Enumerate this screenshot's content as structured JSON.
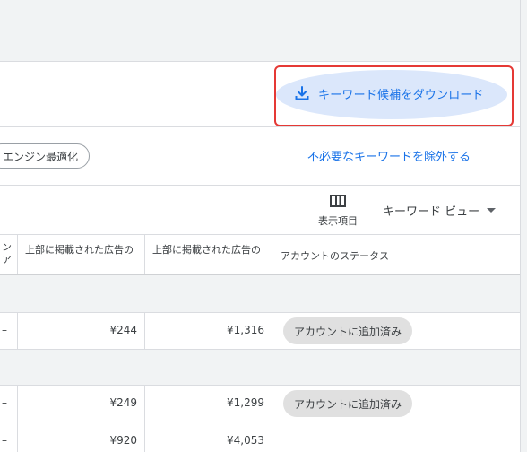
{
  "toolbar": {
    "download_label": "キーワード候補をダウンロード",
    "chip_label": "エンジン最適化",
    "exclude_label": "不必要なキーワードを除外する",
    "columns_label": "表示項目",
    "view_label": "キーワード ビュー"
  },
  "table": {
    "headers": {
      "col0_line1": "ン",
      "col0_line2": "ア",
      "col1": "上部に掲載された広告の",
      "col2": "上部に掲載された広告の",
      "col3": "アカウントのステータス"
    },
    "rows": [
      {
        "dash": "–",
        "low": "¥244",
        "high": "¥1,316",
        "status": "アカウントに追加済み"
      },
      {
        "dash": "–",
        "low": "¥249",
        "high": "¥1,299",
        "status": "アカウントに追加済み"
      },
      {
        "dash": "–",
        "low": "¥920",
        "high": "¥4,053",
        "status": ""
      }
    ]
  },
  "colors": {
    "accent": "#1a73e8",
    "highlight_frame": "#e53935",
    "page_bg": "#f1f3f4"
  },
  "icons": {
    "download": "download-icon",
    "columns": "columns-icon",
    "dropdown": "caret-down-icon"
  }
}
